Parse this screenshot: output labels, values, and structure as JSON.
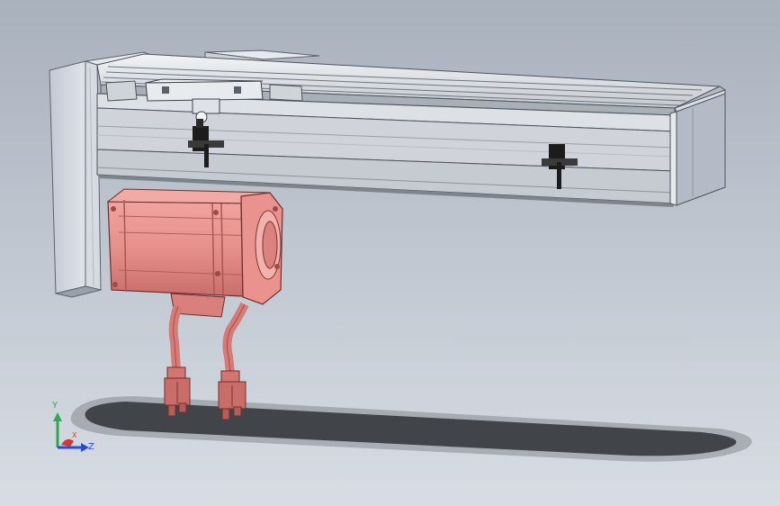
{
  "viewport": {
    "background_top": "#a9b1bd",
    "background_bottom": "#d8dde4"
  },
  "colors": {
    "frame_light": "#e9ecef",
    "frame_mid": "#c9ced4",
    "frame_dark": "#8f959c",
    "end_plate": "#c8cdd6",
    "end_plate_shade": "#a8aebb",
    "motor_body": "#e58f8b",
    "motor_shade": "#c96e6a",
    "motor_dark": "#9e4b48",
    "cable": "#d67b77",
    "connector": "#c96d69",
    "sensor": "#202020",
    "shadow": "#2a2e33"
  },
  "triad": {
    "y_label": "Y",
    "z_label": "Z",
    "x_label": "X",
    "y_color": "#2fa84f",
    "z_color": "#2a4bd6",
    "x_color": "#d23a3a"
  }
}
